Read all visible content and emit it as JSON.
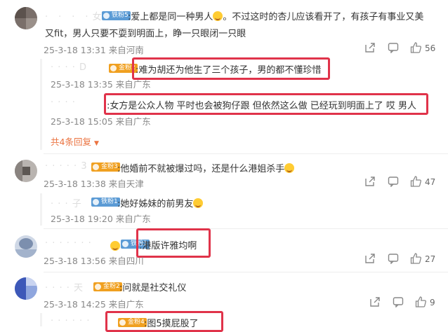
{
  "comments": [
    {
      "user_masked": "·　·　·　· 女",
      "badge": "铁粉5",
      "text_line1": ":爱上都是同一种男人",
      "text_line1_tail": "。不过这时的杏儿应该看开了，有孩子有事业又美",
      "text_line2": "又fit，男人只要不耍到明面上，睁一只眼闭一只眼",
      "time": "25-3-18 13:31",
      "location": "来自河南",
      "likes": "56",
      "replies": [
        {
          "user_masked": "· · ·  · D",
          "badge": "金粉2",
          "text": ":难为胡还为他生了三个孩子，男的都不懂珍惜",
          "time": "25-3-18 13:35",
          "location": "来自广东"
        },
        {
          "user_masked": "· · · ·",
          "badge": "",
          "text": ":女方是公众人物 平时也会被狗仔跟 但依然这么做 已经玩到明面上了 哎 男人",
          "time": "25-3-18 15:05",
          "location": "来自广东"
        }
      ],
      "more_replies": "共4条回复"
    },
    {
      "user_masked": "· · · · · 3",
      "badge": "金粉3",
      "text": ":他婚前不就被爆过吗，还是什么港姐杀手",
      "time": "25-3-18 13:38",
      "location": "来自天津",
      "likes": "47",
      "replies": [
        {
          "user_masked": "· · · 子",
          "badge": "铁粉1",
          "text": ":她好姊妹的前男友",
          "time": "25-3-18 19:20",
          "location": "来自广东"
        }
      ]
    },
    {
      "user_masked": "· · · · · · ·",
      "badge": "铁粉3",
      "text": ":港版许雅均啊",
      "time": "25-3-18 13:56",
      "location": "来自四川",
      "likes": "27"
    },
    {
      "user_masked": "· · · · 天",
      "badge": "金粉2",
      "text": ":问就是社交礼仪",
      "time": "25-3-18 14:25",
      "location": "来自广东",
      "likes": "9",
      "replies": [
        {
          "user_masked": "· · · · · ·",
          "badge": "金粉4",
          "text": ":图5摸屁股了"
        }
      ]
    }
  ],
  "colors": {
    "highlight_box": "#e0334a",
    "more_link": "#eb7340",
    "meta": "#888888"
  }
}
